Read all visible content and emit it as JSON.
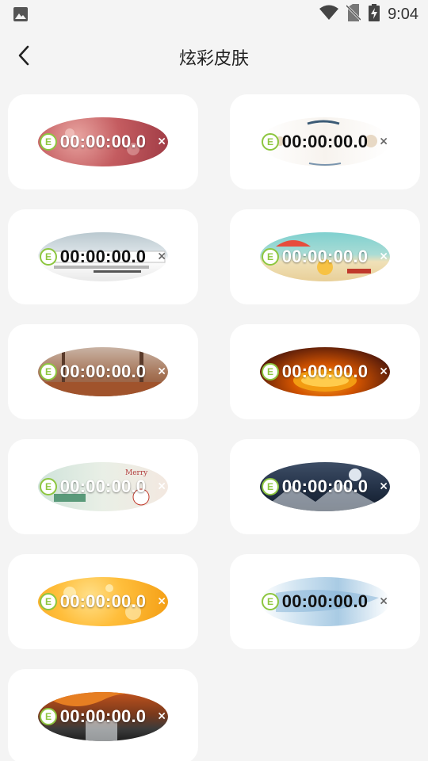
{
  "status_bar": {
    "time": "9:04",
    "icons": [
      "image-icon",
      "wifi-icon",
      "no-sim-icon",
      "battery-charging-icon"
    ]
  },
  "header": {
    "back_icon": "chevron-left-icon",
    "title": "炫彩皮肤"
  },
  "skins": [
    {
      "id": "rose",
      "timer": "00:00:00.0",
      "logo_letter": "E",
      "close_label": "×",
      "text": "light",
      "bg": "radial-gradient(circle at 30% 40%, #e8a4a0 0%, #c45c60 45%, #9e3a44 100%)"
    },
    {
      "id": "leaves",
      "timer": "00:00:00.0",
      "logo_letter": "E",
      "close_label": "×",
      "text": "dark",
      "bg": "linear-gradient(90deg,#ffffff 0%,#f7f3ee 50%,#ffffff 100%)"
    },
    {
      "id": "train",
      "timer": "00:00:00.0",
      "logo_letter": "E",
      "close_label": "×",
      "text": "dark",
      "bg": "linear-gradient(180deg,#b9c8cf 0%,#dfe6ea 45%,#ffffff 55%,#e9e9e9 100%)"
    },
    {
      "id": "beach",
      "timer": "00:00:00.0",
      "logo_letter": "E",
      "close_label": "×",
      "text": "light",
      "bg": "linear-gradient(180deg,#7fd0cf 0%,#a9dcd5 45%,#f0e1b8 60%,#e8cf98 100%)"
    },
    {
      "id": "autumn-forest",
      "timer": "00:00:00.0",
      "logo_letter": "E",
      "close_label": "×",
      "text": "light",
      "bg": "linear-gradient(180deg,#c9b3a4 0%,#a57457 55%,#8c4a2a 100%)"
    },
    {
      "id": "pumpkin",
      "timer": "00:00:00.0",
      "logo_letter": "E",
      "close_label": "×",
      "text": "light",
      "bg": "radial-gradient(ellipse at 50% 70%, #f5a623 0%, #d35400 35%, #5a1d0a 75%, #2a0c04 100%)"
    },
    {
      "id": "christmas",
      "timer": "00:00:00.0",
      "logo_letter": "E",
      "close_label": "×",
      "text": "light",
      "bg": "linear-gradient(90deg,#cfe3da 0%,#e9efe6 50%,#f3e8e0 100%)"
    },
    {
      "id": "night-sky",
      "timer": "00:00:00.0",
      "logo_letter": "E",
      "close_label": "×",
      "text": "light",
      "bg": "linear-gradient(180deg,#3e4e66 0%,#253349 50%,#101a2a 100%)"
    },
    {
      "id": "orange-bokeh",
      "timer": "00:00:00.0",
      "logo_letter": "E",
      "close_label": "×",
      "text": "light",
      "bg": "radial-gradient(circle at 40% 40%, #ffe08a 0%, #ffbe3b 40%, #f39c12 100%)"
    },
    {
      "id": "ink-blue",
      "timer": "00:00:00.0",
      "logo_letter": "E",
      "close_label": "×",
      "text": "dark",
      "bg": "linear-gradient(90deg,#ffffff 0%,#cfe3f1 30%,#a9cbe4 60%,#ffffff 100%)"
    },
    {
      "id": "waterfall",
      "timer": "00:00:00.0",
      "logo_letter": "E",
      "close_label": "×",
      "text": "light",
      "bg": "linear-gradient(180deg,#c0521d 0%,#7a3a1c 45%,#3b3b3b 75%,#1e1e1e 100%)"
    }
  ],
  "colors": {
    "background": "#f4f4f4",
    "card": "#ffffff",
    "logo_green": "#8dc63f"
  }
}
